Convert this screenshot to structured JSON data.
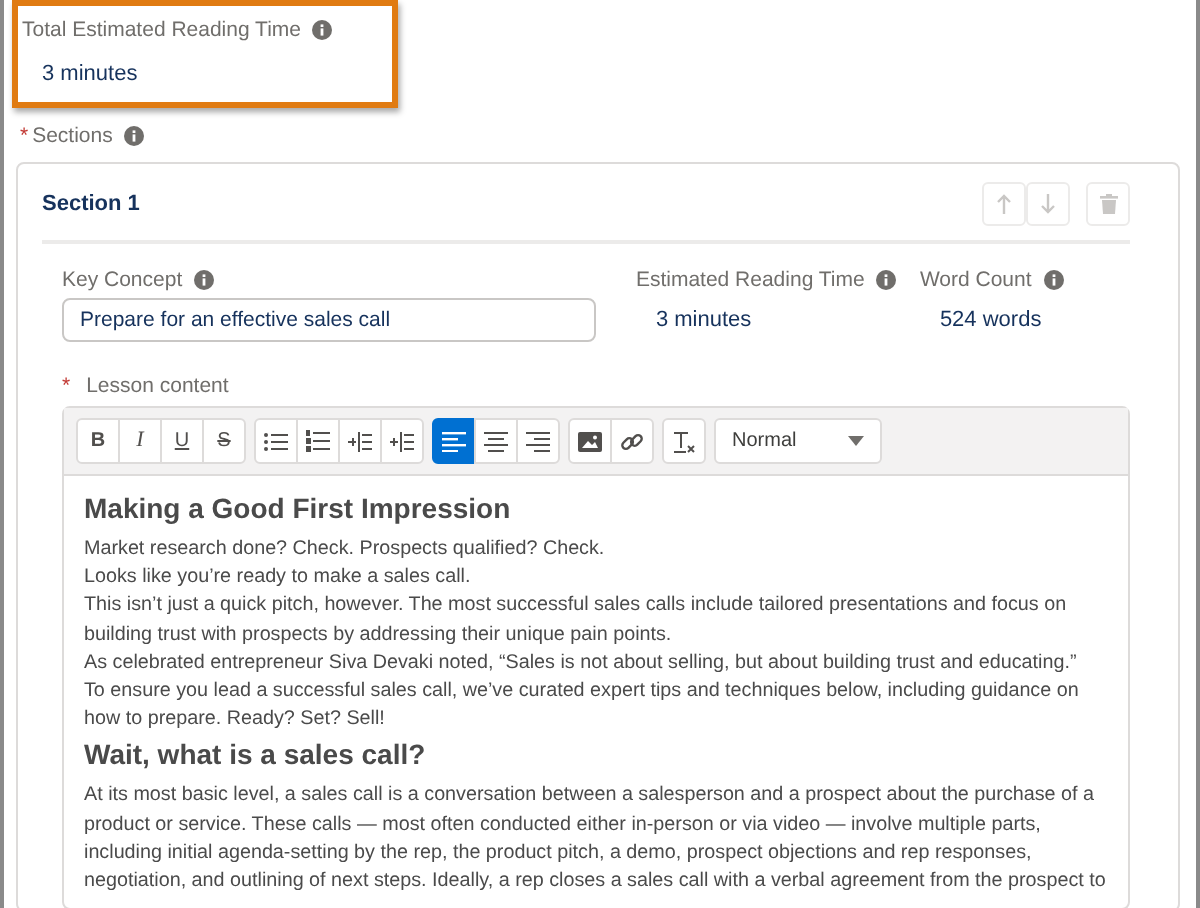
{
  "total_reading_time": {
    "label": "Total Estimated Reading Time",
    "value": "3 minutes",
    "highlighted": true
  },
  "sections_field": {
    "label": "Sections",
    "required_marker": "*"
  },
  "sections": [
    {
      "title": "Section 1",
      "actions": [
        {
          "kind": "up",
          "disabled": true
        },
        {
          "kind": "down",
          "disabled": true
        },
        {
          "kind": "delete",
          "disabled": true
        }
      ],
      "key_concept": {
        "label": "Key Concept",
        "value": "Prepare for an effective sales call"
      },
      "estimated_reading_time": {
        "label": "Estimated Reading Time",
        "value": "3 minutes"
      },
      "word_count": {
        "label": "Word Count",
        "value": "524 words"
      },
      "lesson_content": {
        "label": "Lesson content",
        "required_marker": "*",
        "toolbar": [
          [
            {
              "kind": "bold",
              "glyph": "B",
              "selected": false
            },
            {
              "kind": "italic",
              "glyph": "I",
              "selected": false
            },
            {
              "kind": "underline",
              "glyph": "U",
              "selected": false
            },
            {
              "kind": "strike",
              "glyph": "S",
              "selected": false
            }
          ],
          [
            {
              "kind": "bullets",
              "selected": false
            },
            {
              "kind": "numbers",
              "selected": false
            },
            {
              "kind": "outdent",
              "selected": false
            },
            {
              "kind": "indent",
              "selected": false
            }
          ],
          [
            {
              "kind": "align-left",
              "selected": true
            },
            {
              "kind": "align-center",
              "selected": false
            },
            {
              "kind": "align-right",
              "selected": false
            }
          ],
          [
            {
              "kind": "image",
              "selected": false
            },
            {
              "kind": "link",
              "selected": false
            }
          ],
          [
            {
              "kind": "clear",
              "selected": false
            }
          ]
        ],
        "format": "Normal",
        "blocks": [
          {
            "kind": "heading",
            "text": "Making a Good First Impression"
          },
          {
            "kind": "paragraph",
            "text": "Market research done? Check. Prospects qualified? Check."
          },
          {
            "kind": "paragraph",
            "text": "Looks like you’re ready to make a sales call."
          },
          {
            "kind": "paragraph",
            "text": "This isn’t just a quick pitch, however. The most successful sales calls include tailored presentations and focus on building trust with prospects by addressing their unique pain points."
          },
          {
            "kind": "paragraph",
            "text": "As celebrated entrepreneur Siva Devaki noted, “Sales is not about selling, but about building trust and educating.”"
          },
          {
            "kind": "paragraph",
            "text": "To ensure you lead a successful sales call, we’ve curated expert tips and techniques below, including guidance on how to prepare. Ready? Set? Sell!"
          },
          {
            "kind": "heading",
            "text": "Wait, what is a sales call?"
          },
          {
            "kind": "paragraph",
            "text": "At its most basic level, a sales call is a conversation between a salesperson and a prospect about the purchase of a product or service. These calls — most often conducted either in-person or via video — involve multiple parts, including initial agenda-setting by the rep, the product pitch, a demo, prospect objections and rep responses, negotiation, and outlining of next steps. Ideally, a rep closes a sales call with a verbal agreement from the prospect to"
          }
        ]
      }
    }
  ]
}
